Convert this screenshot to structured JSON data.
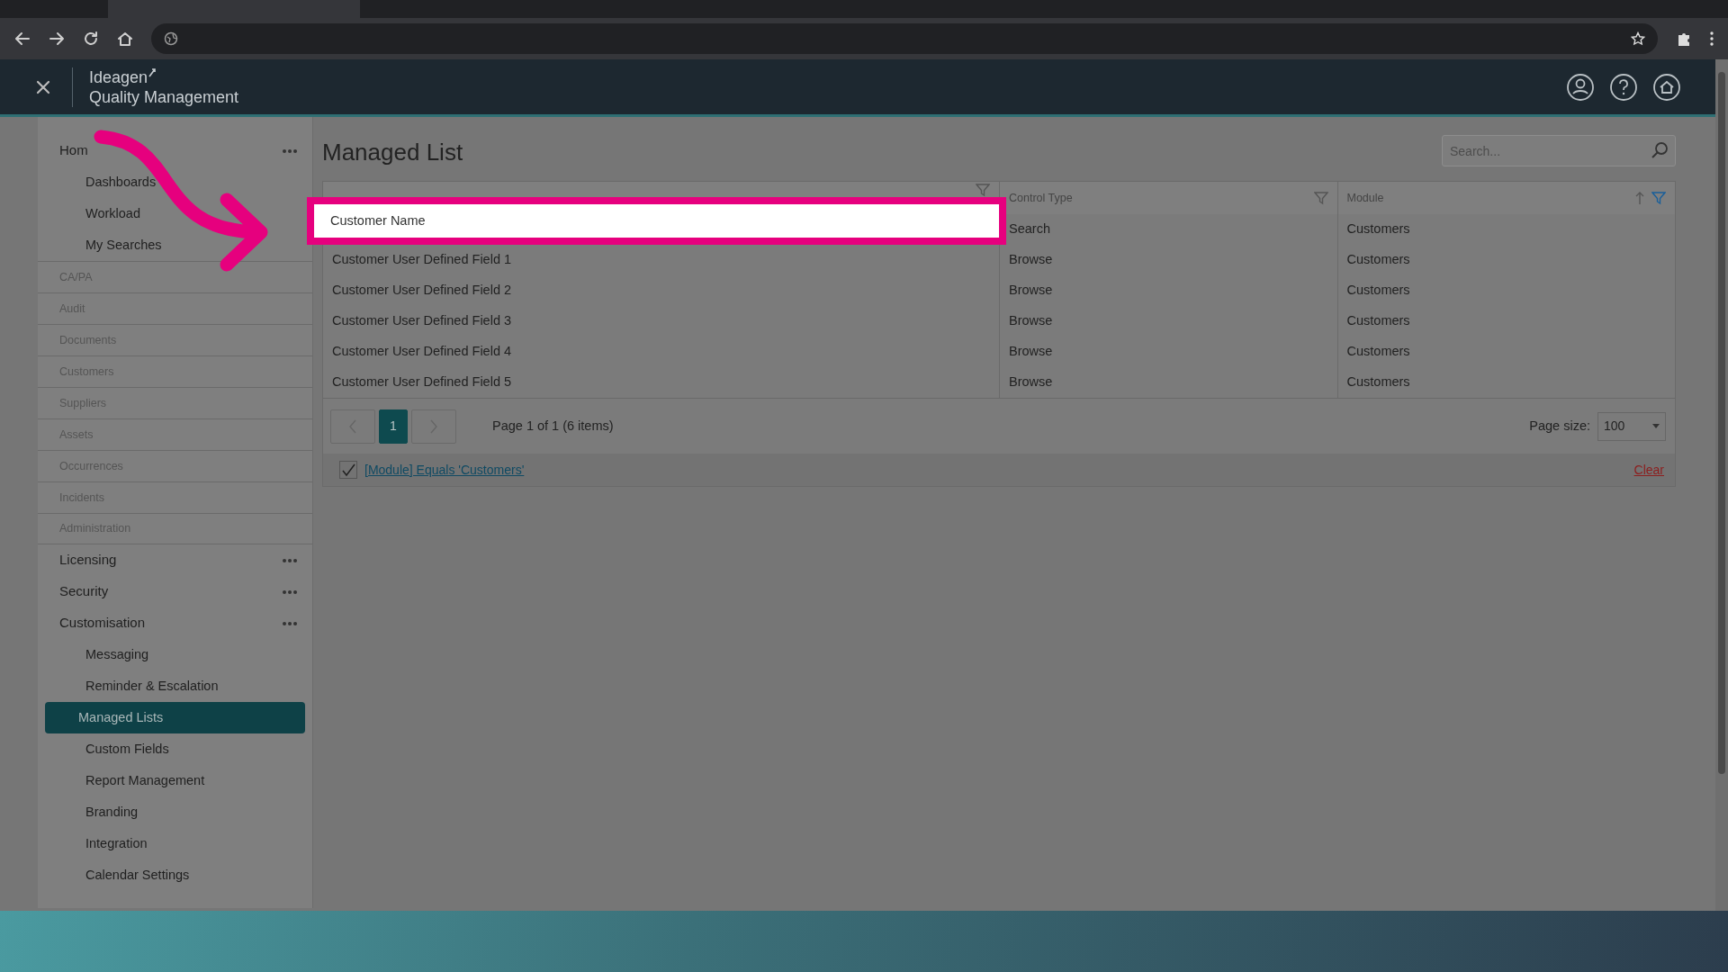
{
  "app": {
    "brand": "Ideagen",
    "product": "Quality Management"
  },
  "sidebar": {
    "items": [
      {
        "label": "Hom",
        "kind": "group",
        "selected": false,
        "children": [
          {
            "label": "Dashboards",
            "selected": false
          },
          {
            "label": "Workload",
            "selected": false
          },
          {
            "label": "My Searches",
            "selected": false
          }
        ]
      },
      {
        "label": "CA/PA",
        "kind": "module",
        "selected": false
      },
      {
        "label": "Audit",
        "kind": "module",
        "selected": false
      },
      {
        "label": "Documents",
        "kind": "module",
        "selected": false
      },
      {
        "label": "Customers",
        "kind": "module",
        "selected": false
      },
      {
        "label": "Suppliers",
        "kind": "module",
        "selected": false
      },
      {
        "label": "Assets",
        "kind": "module",
        "selected": false
      },
      {
        "label": "Occurrences",
        "kind": "module",
        "selected": false
      },
      {
        "label": "Incidents",
        "kind": "module",
        "selected": false
      },
      {
        "label": "Administration",
        "kind": "module",
        "selected": false
      },
      {
        "label": "Licensing",
        "kind": "group",
        "selected": false
      },
      {
        "label": "Security",
        "kind": "group",
        "selected": false
      },
      {
        "label": "Customisation",
        "kind": "group",
        "selected": false,
        "children": [
          {
            "label": "Messaging",
            "selected": false
          },
          {
            "label": "Reminder & Escalation",
            "selected": false
          },
          {
            "label": "Managed Lists",
            "selected": true
          },
          {
            "label": "Custom Fields",
            "selected": false
          },
          {
            "label": "Report Management",
            "selected": false
          },
          {
            "label": "Branding",
            "selected": false
          },
          {
            "label": "Integration",
            "selected": false
          },
          {
            "label": "Calendar Settings",
            "selected": false
          }
        ]
      }
    ]
  },
  "page": {
    "title": "Managed List",
    "search": {
      "placeholder": "Search..."
    }
  },
  "table": {
    "columns": [
      {
        "filter_active": false
      },
      {
        "label": "Control Type",
        "filter_active": false
      },
      {
        "label": "Module",
        "filter_active": true,
        "sort_ascending": true
      }
    ],
    "rows": [
      {
        "cells": [
          "Customer Name",
          "Search",
          "Customers"
        ],
        "spotlight": true
      },
      {
        "cells": [
          "Customer User Defined Field 1",
          "Browse",
          "Customers"
        ],
        "spotlight": false
      },
      {
        "cells": [
          "Customer User Defined Field 2",
          "Browse",
          "Customers"
        ],
        "spotlight": false
      },
      {
        "cells": [
          "Customer User Defined Field 3",
          "Browse",
          "Customers"
        ],
        "spotlight": false
      },
      {
        "cells": [
          "Customer User Defined Field 4",
          "Browse",
          "Customers"
        ],
        "spotlight": false
      },
      {
        "cells": [
          "Customer User Defined Field 5",
          "Browse",
          "Customers"
        ],
        "spotlight": false
      }
    ]
  },
  "pager": {
    "pages": [
      {
        "label": "1",
        "selected": true
      }
    ],
    "info": "Page 1 of 1 (6 items)",
    "page_size_label": "Page size:",
    "page_size": "100"
  },
  "filter": {
    "checked": true,
    "text": "[Module] Equals 'Customers'",
    "clear": "Clear"
  }
}
